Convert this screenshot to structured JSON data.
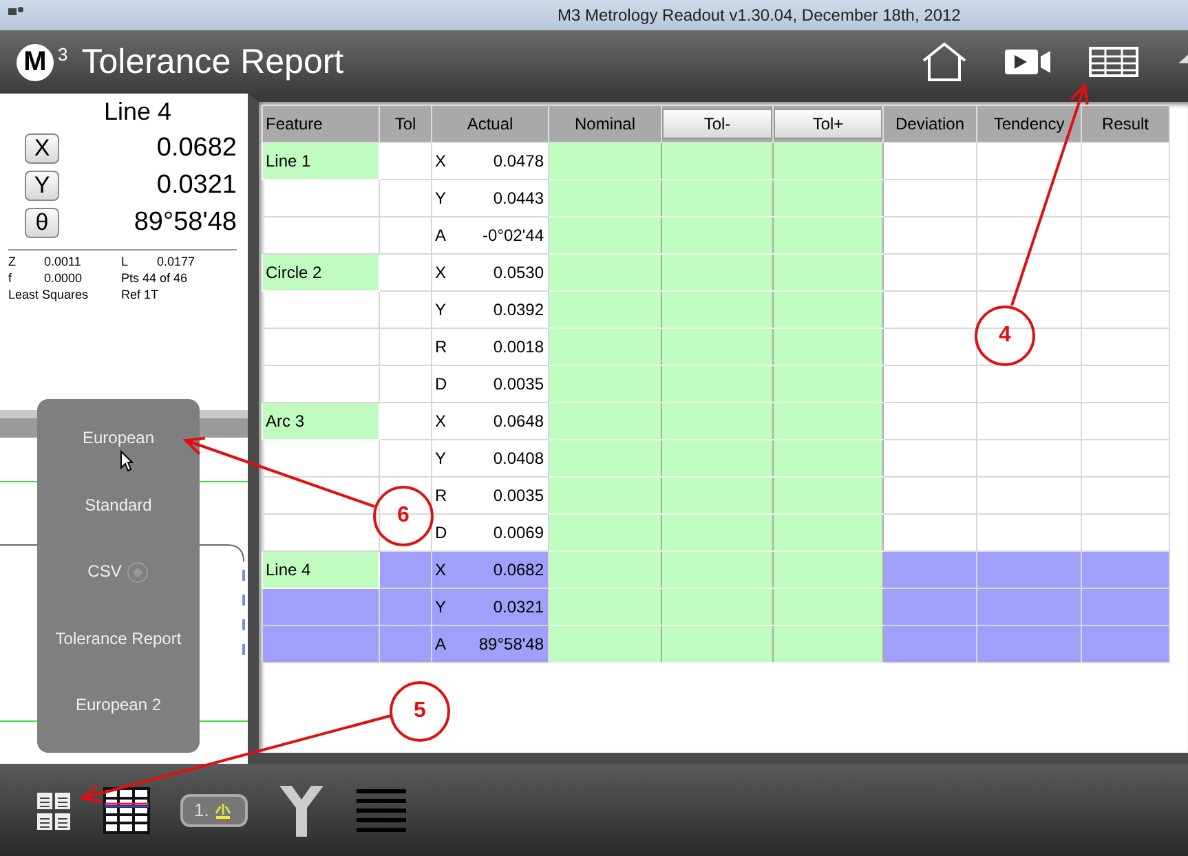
{
  "window": {
    "title": "M3 Metrology Readout  v1.30.04, December 18th, 2012"
  },
  "header": {
    "logo_letter": "M",
    "logo_sup": "3",
    "title": "Tolerance Report"
  },
  "readout": {
    "feature": "Line 4",
    "axes": [
      {
        "label": "X",
        "value": "0.0682"
      },
      {
        "label": "Y",
        "value": "0.0321"
      },
      {
        "label": "θ",
        "value": "89°58'48"
      }
    ],
    "stats": [
      {
        "key": "Z",
        "value": "0.0011"
      },
      {
        "key": "L",
        "value": "0.0177"
      },
      {
        "key": "f",
        "value": "0.0000"
      },
      {
        "key": "Pts 44 of 46"
      },
      {
        "key": "Least Squares"
      },
      {
        "key": "Ref 1T"
      }
    ]
  },
  "menu": {
    "items": [
      {
        "label": "European",
        "kind": "plain"
      },
      {
        "label": "Standard",
        "kind": "plain"
      },
      {
        "label": "CSV",
        "kind": "radio"
      },
      {
        "label": "Tolerance Report",
        "kind": "plain"
      },
      {
        "label": "European 2",
        "kind": "plain"
      }
    ]
  },
  "table": {
    "columns": [
      {
        "label": "Feature",
        "kind": "label"
      },
      {
        "label": "Tol",
        "kind": "label"
      },
      {
        "label": "Actual",
        "kind": "label"
      },
      {
        "label": "Nominal",
        "kind": "label"
      },
      {
        "label": "Tol-",
        "kind": "button"
      },
      {
        "label": "Tol+",
        "kind": "button"
      },
      {
        "label": "Deviation",
        "kind": "label"
      },
      {
        "label": "Tendency",
        "kind": "label"
      },
      {
        "label": "Result",
        "kind": "label"
      }
    ],
    "features": [
      {
        "name": "Line 1",
        "selected": false,
        "rows": [
          {
            "axis": "X",
            "actual": "0.0478"
          },
          {
            "axis": "Y",
            "actual": "0.0443"
          },
          {
            "axis": "A",
            "actual": "-0°02'44"
          }
        ]
      },
      {
        "name": "Circle 2",
        "selected": false,
        "rows": [
          {
            "axis": "X",
            "actual": "0.0530"
          },
          {
            "axis": "Y",
            "actual": "0.0392"
          },
          {
            "axis": "R",
            "actual": "0.0018"
          },
          {
            "axis": "D",
            "actual": "0.0035"
          }
        ]
      },
      {
        "name": "Arc 3",
        "selected": false,
        "rows": [
          {
            "axis": "X",
            "actual": "0.0648"
          },
          {
            "axis": "Y",
            "actual": "0.0408"
          },
          {
            "axis": "R",
            "actual": "0.0035"
          },
          {
            "axis": "D",
            "actual": "0.0069"
          }
        ]
      },
      {
        "name": "Line 4",
        "selected": true,
        "rows": [
          {
            "axis": "X",
            "actual": "0.0682"
          },
          {
            "axis": "Y",
            "actual": "0.0321"
          },
          {
            "axis": "A",
            "actual": "89°58'48"
          }
        ]
      }
    ]
  },
  "toolbar": {
    "key_label": "1."
  },
  "annotations": [
    {
      "number": "4"
    },
    {
      "number": "5"
    },
    {
      "number": "6"
    }
  ]
}
